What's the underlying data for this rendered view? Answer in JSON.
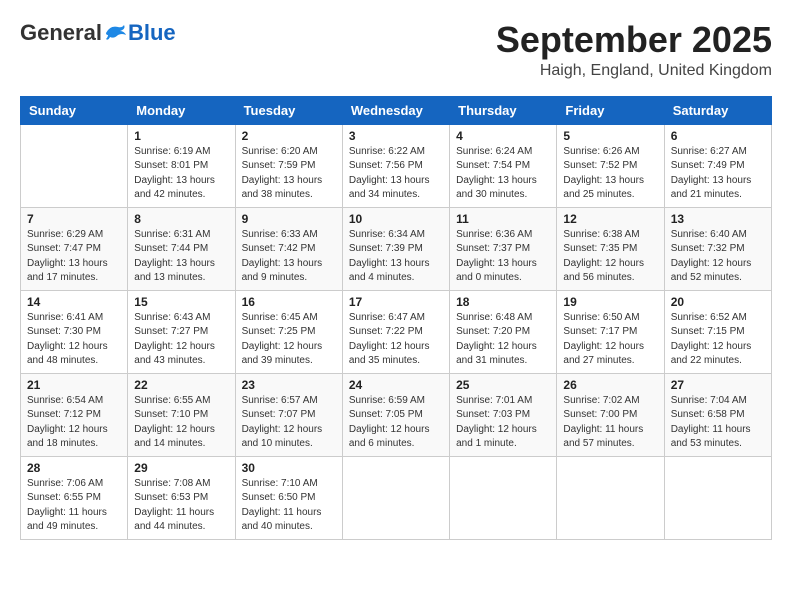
{
  "header": {
    "logo_general": "General",
    "logo_blue": "Blue",
    "month_title": "September 2025",
    "location": "Haigh, England, United Kingdom"
  },
  "weekdays": [
    "Sunday",
    "Monday",
    "Tuesday",
    "Wednesday",
    "Thursday",
    "Friday",
    "Saturday"
  ],
  "weeks": [
    [
      {
        "day": null
      },
      {
        "day": 1,
        "sunrise": "6:19 AM",
        "sunset": "8:01 PM",
        "daylight": "13 hours and 42 minutes."
      },
      {
        "day": 2,
        "sunrise": "6:20 AM",
        "sunset": "7:59 PM",
        "daylight": "13 hours and 38 minutes."
      },
      {
        "day": 3,
        "sunrise": "6:22 AM",
        "sunset": "7:56 PM",
        "daylight": "13 hours and 34 minutes."
      },
      {
        "day": 4,
        "sunrise": "6:24 AM",
        "sunset": "7:54 PM",
        "daylight": "13 hours and 30 minutes."
      },
      {
        "day": 5,
        "sunrise": "6:26 AM",
        "sunset": "7:52 PM",
        "daylight": "13 hours and 25 minutes."
      },
      {
        "day": 6,
        "sunrise": "6:27 AM",
        "sunset": "7:49 PM",
        "daylight": "13 hours and 21 minutes."
      }
    ],
    [
      {
        "day": 7,
        "sunrise": "6:29 AM",
        "sunset": "7:47 PM",
        "daylight": "13 hours and 17 minutes."
      },
      {
        "day": 8,
        "sunrise": "6:31 AM",
        "sunset": "7:44 PM",
        "daylight": "13 hours and 13 minutes."
      },
      {
        "day": 9,
        "sunrise": "6:33 AM",
        "sunset": "7:42 PM",
        "daylight": "13 hours and 9 minutes."
      },
      {
        "day": 10,
        "sunrise": "6:34 AM",
        "sunset": "7:39 PM",
        "daylight": "13 hours and 4 minutes."
      },
      {
        "day": 11,
        "sunrise": "6:36 AM",
        "sunset": "7:37 PM",
        "daylight": "13 hours and 0 minutes."
      },
      {
        "day": 12,
        "sunrise": "6:38 AM",
        "sunset": "7:35 PM",
        "daylight": "12 hours and 56 minutes."
      },
      {
        "day": 13,
        "sunrise": "6:40 AM",
        "sunset": "7:32 PM",
        "daylight": "12 hours and 52 minutes."
      }
    ],
    [
      {
        "day": 14,
        "sunrise": "6:41 AM",
        "sunset": "7:30 PM",
        "daylight": "12 hours and 48 minutes."
      },
      {
        "day": 15,
        "sunrise": "6:43 AM",
        "sunset": "7:27 PM",
        "daylight": "12 hours and 43 minutes."
      },
      {
        "day": 16,
        "sunrise": "6:45 AM",
        "sunset": "7:25 PM",
        "daylight": "12 hours and 39 minutes."
      },
      {
        "day": 17,
        "sunrise": "6:47 AM",
        "sunset": "7:22 PM",
        "daylight": "12 hours and 35 minutes."
      },
      {
        "day": 18,
        "sunrise": "6:48 AM",
        "sunset": "7:20 PM",
        "daylight": "12 hours and 31 minutes."
      },
      {
        "day": 19,
        "sunrise": "6:50 AM",
        "sunset": "7:17 PM",
        "daylight": "12 hours and 27 minutes."
      },
      {
        "day": 20,
        "sunrise": "6:52 AM",
        "sunset": "7:15 PM",
        "daylight": "12 hours and 22 minutes."
      }
    ],
    [
      {
        "day": 21,
        "sunrise": "6:54 AM",
        "sunset": "7:12 PM",
        "daylight": "12 hours and 18 minutes."
      },
      {
        "day": 22,
        "sunrise": "6:55 AM",
        "sunset": "7:10 PM",
        "daylight": "12 hours and 14 minutes."
      },
      {
        "day": 23,
        "sunrise": "6:57 AM",
        "sunset": "7:07 PM",
        "daylight": "12 hours and 10 minutes."
      },
      {
        "day": 24,
        "sunrise": "6:59 AM",
        "sunset": "7:05 PM",
        "daylight": "12 hours and 6 minutes."
      },
      {
        "day": 25,
        "sunrise": "7:01 AM",
        "sunset": "7:03 PM",
        "daylight": "12 hours and 1 minute."
      },
      {
        "day": 26,
        "sunrise": "7:02 AM",
        "sunset": "7:00 PM",
        "daylight": "11 hours and 57 minutes."
      },
      {
        "day": 27,
        "sunrise": "7:04 AM",
        "sunset": "6:58 PM",
        "daylight": "11 hours and 53 minutes."
      }
    ],
    [
      {
        "day": 28,
        "sunrise": "7:06 AM",
        "sunset": "6:55 PM",
        "daylight": "11 hours and 49 minutes."
      },
      {
        "day": 29,
        "sunrise": "7:08 AM",
        "sunset": "6:53 PM",
        "daylight": "11 hours and 44 minutes."
      },
      {
        "day": 30,
        "sunrise": "7:10 AM",
        "sunset": "6:50 PM",
        "daylight": "11 hours and 40 minutes."
      },
      {
        "day": null
      },
      {
        "day": null
      },
      {
        "day": null
      },
      {
        "day": null
      }
    ]
  ]
}
